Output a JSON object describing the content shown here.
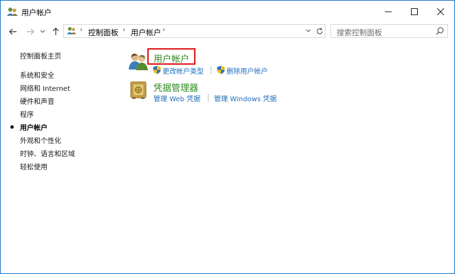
{
  "window": {
    "title": "用户帐户",
    "controls": {
      "minimize": "—",
      "maximize": "☐",
      "close": "✕"
    }
  },
  "nav": {
    "back": "←",
    "forward": "→",
    "recent": "⌄",
    "up": "↑",
    "breadcrumb": [
      "控制面板",
      "用户帐户"
    ],
    "breadcrumb_sep": "›",
    "dropdown": "⌄",
    "refresh": "↻",
    "search_placeholder": "搜索控制面板"
  },
  "sidebar": {
    "items": [
      {
        "label": "控制面板主页",
        "active": false
      },
      {
        "label": "系统和安全",
        "active": false
      },
      {
        "label": "网络和 Internet",
        "active": false
      },
      {
        "label": "硬件和声音",
        "active": false
      },
      {
        "label": "程序",
        "active": false
      },
      {
        "label": "用户帐户",
        "active": true
      },
      {
        "label": "外观和个性化",
        "active": false
      },
      {
        "label": "时钟、语言和区域",
        "active": false
      },
      {
        "label": "轻松使用",
        "active": false
      }
    ]
  },
  "main": {
    "categories": [
      {
        "title": "用户帐户",
        "icon": "users-icon",
        "highlighted": true,
        "links": [
          "更改帐户类型",
          "删除用户帐户"
        ]
      },
      {
        "title": "凭据管理器",
        "icon": "vault-icon",
        "highlighted": false,
        "links": [
          "管理 Web 凭据",
          "管理 Windows 凭据"
        ]
      }
    ]
  },
  "colors": {
    "accent_border": "#1979ca",
    "category_title": "#2a8a1c",
    "link": "#1e6fbd",
    "highlight_box": "#e01515"
  }
}
